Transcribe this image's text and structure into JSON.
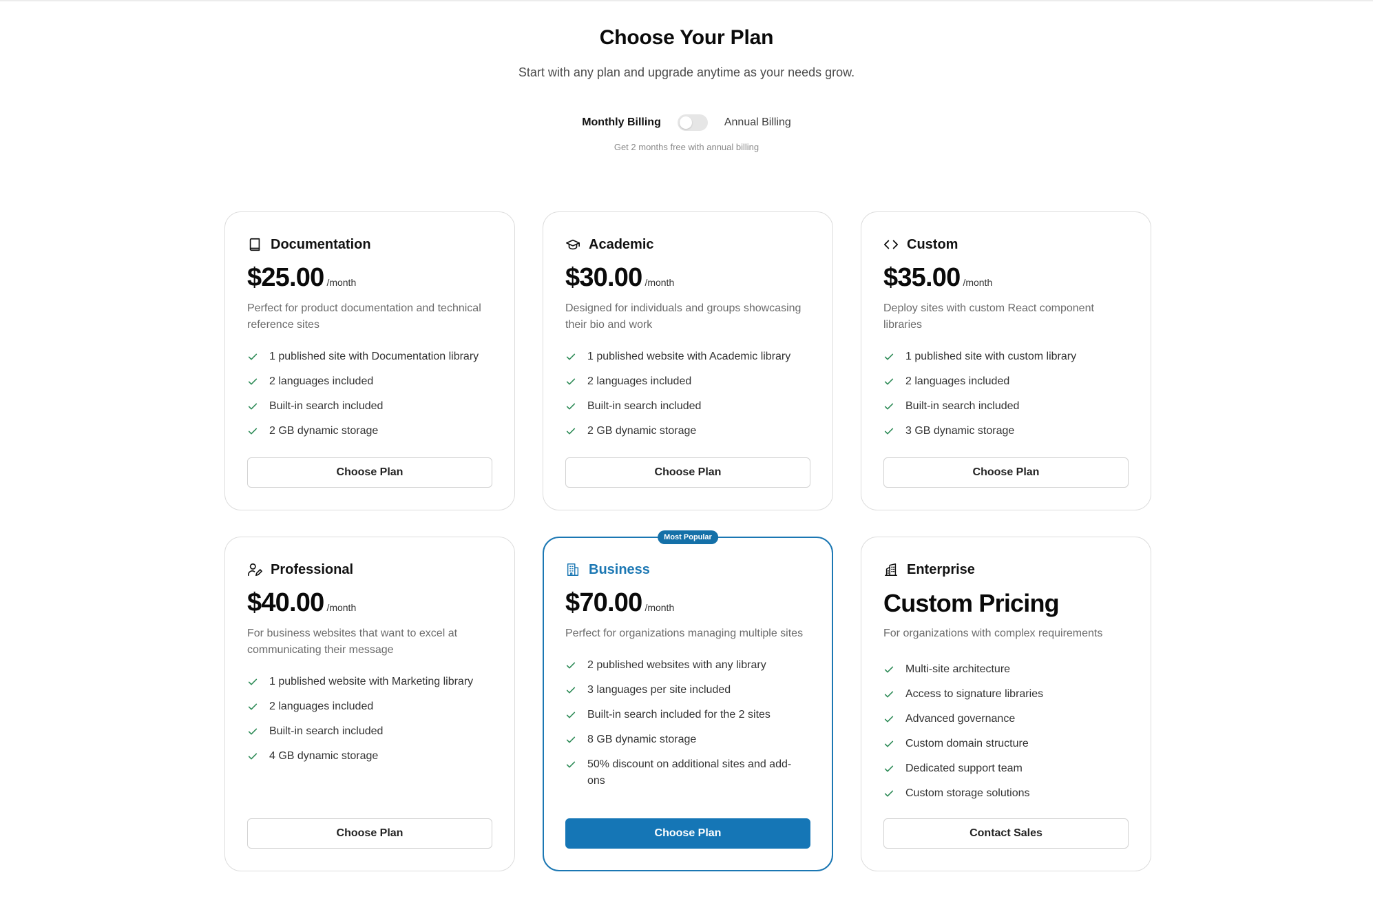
{
  "header": {
    "title": "Choose Your Plan",
    "subtitle": "Start with any plan and upgrade anytime as your needs grow."
  },
  "billing": {
    "monthly_label": "Monthly Billing",
    "annual_label": "Annual Billing",
    "toggle_state": "monthly",
    "note": "Get 2 months free with annual billing"
  },
  "colors": {
    "accent": "#1576b6",
    "check": "#2e8b57",
    "border": "#dcdcdc"
  },
  "plans": [
    {
      "icon": "book-icon",
      "name": "Documentation",
      "price": "$25.00",
      "period": "/month",
      "description": "Perfect for product documentation and technical reference sites",
      "features": [
        "1 published site with Documentation library",
        "2 languages included",
        "Built-in search included",
        "2 GB dynamic storage"
      ],
      "button": "Choose Plan"
    },
    {
      "icon": "graduation-cap-icon",
      "name": "Academic",
      "price": "$30.00",
      "period": "/month",
      "description": "Designed for individuals and groups showcasing their bio and work",
      "features": [
        "1 published website with Academic library",
        "2 languages included",
        "Built-in search included",
        "2 GB dynamic storage"
      ],
      "button": "Choose Plan"
    },
    {
      "icon": "code-icon",
      "name": "Custom",
      "price": "$35.00",
      "period": "/month",
      "description": "Deploy sites with custom React component libraries",
      "features": [
        "1 published site with custom library",
        "2 languages included",
        "Built-in search included",
        "3 GB dynamic storage"
      ],
      "button": "Choose Plan"
    },
    {
      "icon": "user-pen-icon",
      "name": "Professional",
      "price": "$40.00",
      "period": "/month",
      "description": "For business websites that want to excel at communicating their message",
      "features": [
        "1 published website with Marketing library",
        "2 languages included",
        "Built-in search included",
        "4 GB dynamic storage"
      ],
      "button": "Choose Plan"
    },
    {
      "icon": "building-icon",
      "name": "Business",
      "badge": "Most Popular",
      "price": "$70.00",
      "period": "/month",
      "description": "Perfect for organizations managing multiple sites",
      "features": [
        "2 published websites with any library",
        "3 languages per site included",
        "Built-in search included for the 2 sites",
        "8 GB dynamic storage",
        "50% discount on additional sites and add-ons"
      ],
      "button": "Choose Plan"
    },
    {
      "icon": "buildings-icon",
      "name": "Enterprise",
      "price_text": "Custom Pricing",
      "description": "For organizations with complex requirements",
      "features": [
        "Multi-site architecture",
        "Access to signature libraries",
        "Advanced governance",
        "Custom domain structure",
        "Dedicated support team",
        "Custom storage solutions"
      ],
      "button": "Contact Sales"
    }
  ]
}
